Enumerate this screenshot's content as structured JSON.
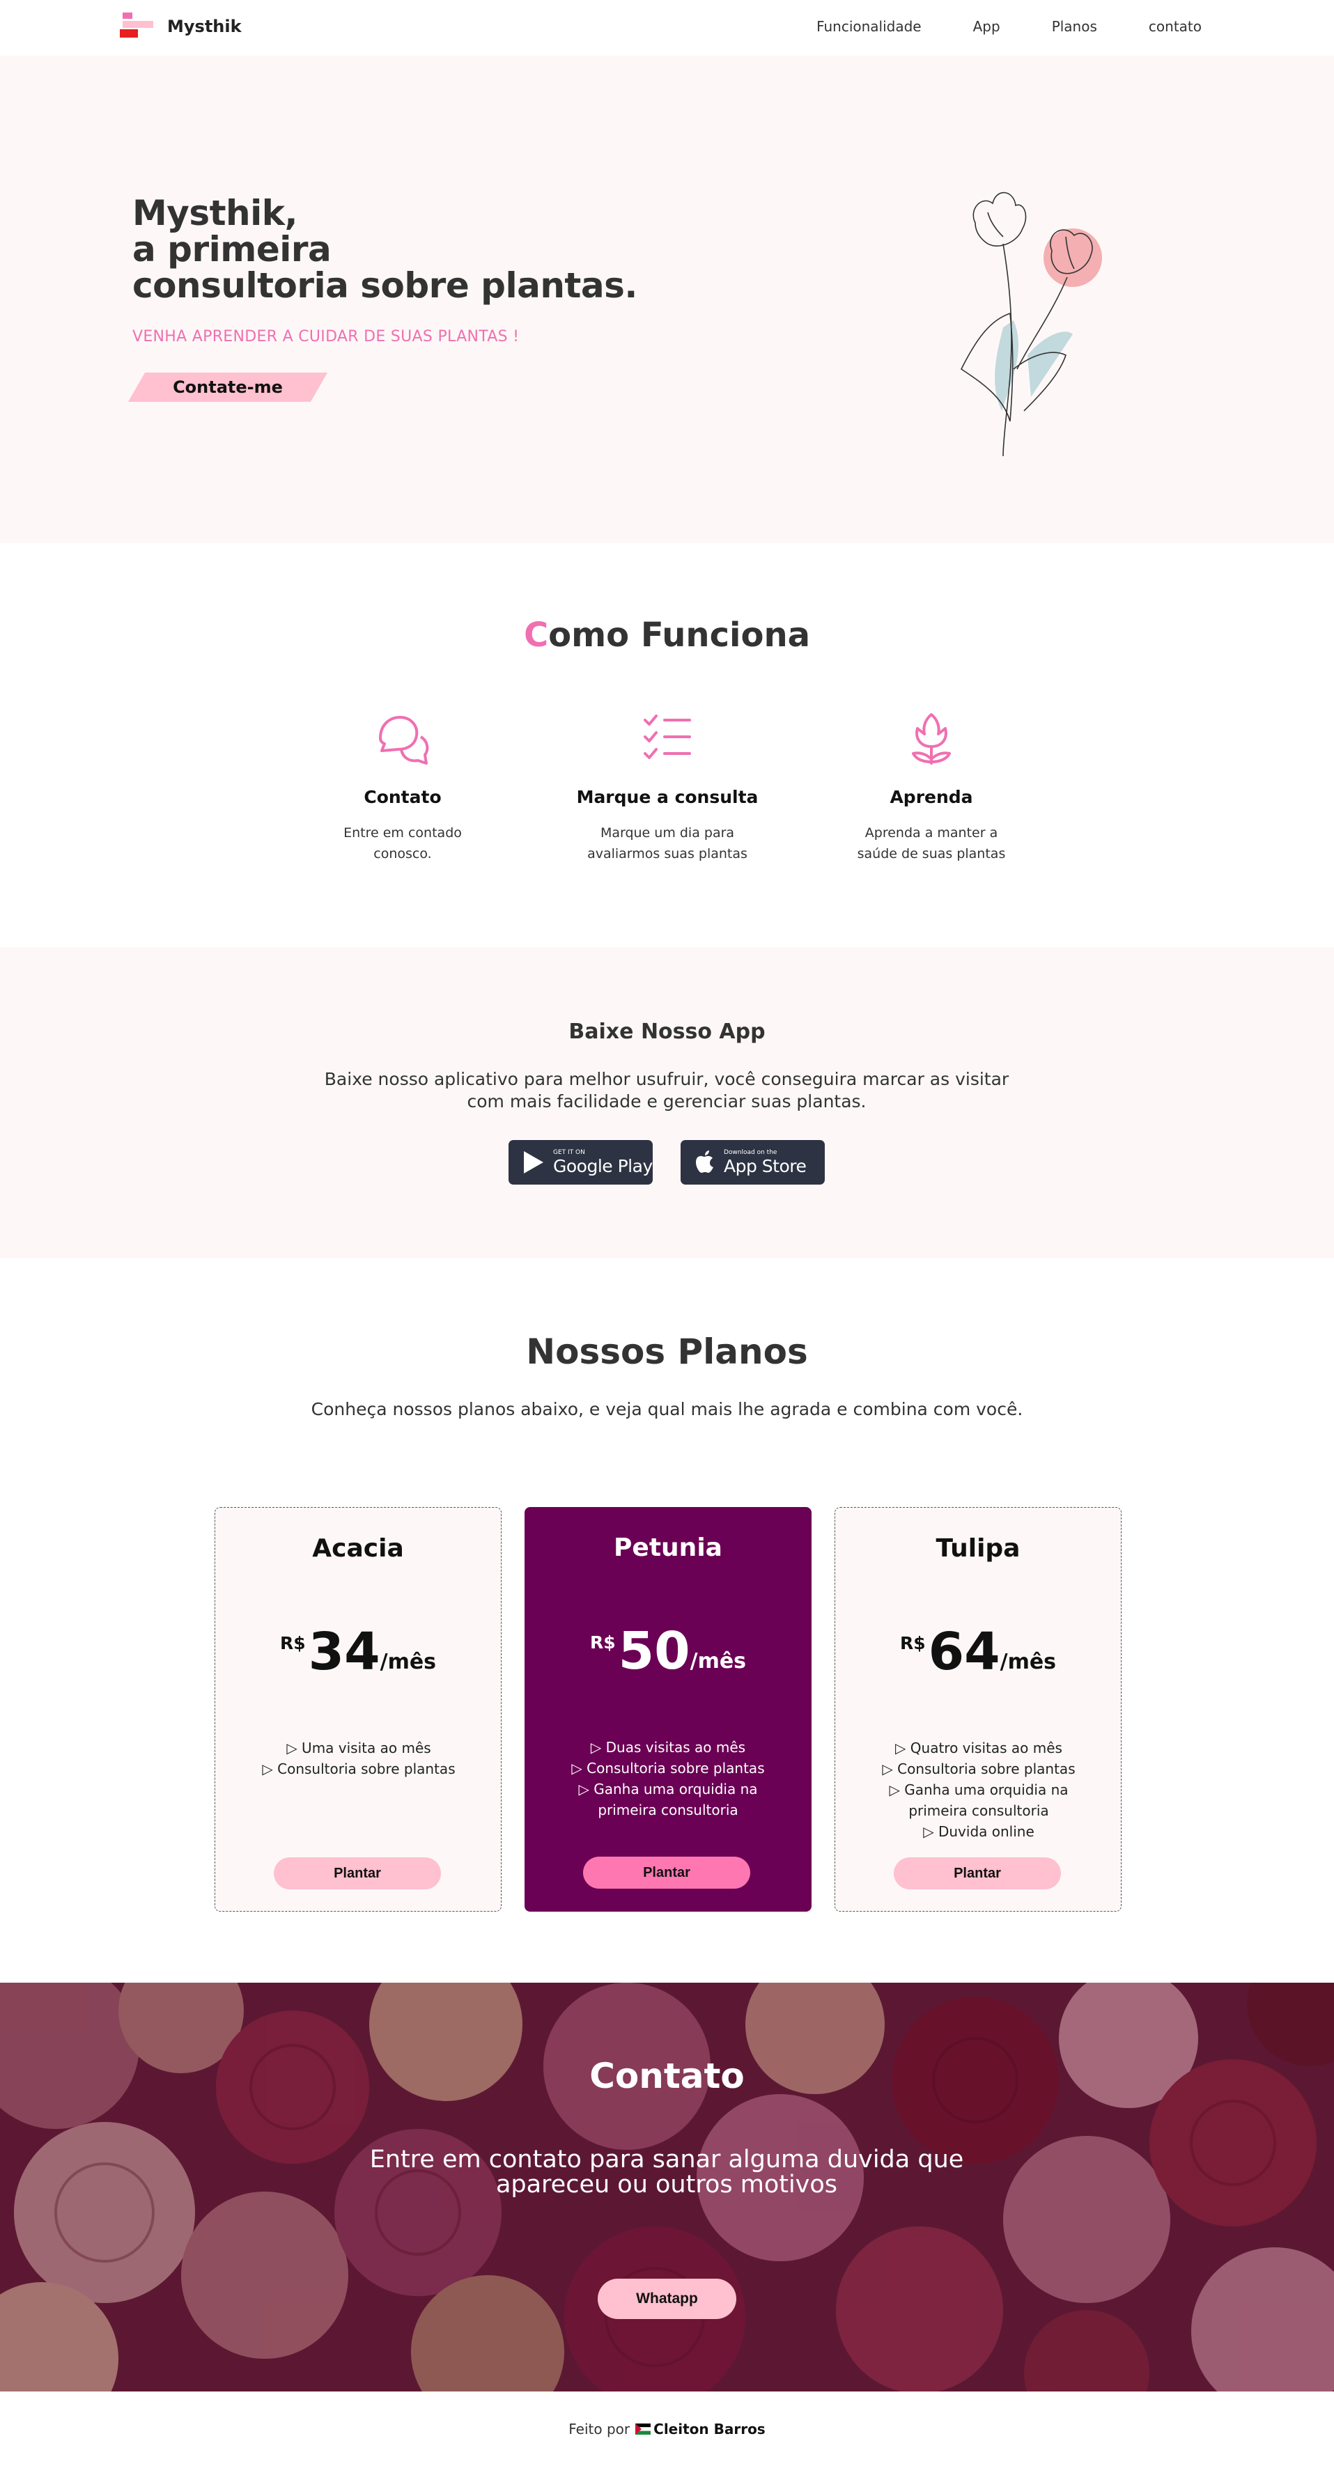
{
  "header": {
    "brand": "Mysthik",
    "nav": [
      "Funcionalidade",
      "App",
      "Planos",
      "contato"
    ]
  },
  "hero": {
    "title_line1": "Mysthik,",
    "title_line2": "a primeira",
    "title_line3": "consultoria sobre plantas.",
    "subtitle": "VENHA APRENDER A CUIDAR DE SUAS PLANTAS !",
    "cta": "Contate-me",
    "illustration_icon": "tulip-illustration"
  },
  "como_funciona": {
    "title_first": "C",
    "title_rest": "omo Funciona",
    "items": [
      {
        "icon": "chat-bubbles-icon",
        "title": "Contato",
        "text_line1": "Entre em contado",
        "text_line2": "conosco."
      },
      {
        "icon": "checklist-icon",
        "title": "Marque a consulta",
        "text_line1": "Marque um dia para",
        "text_line2": "avaliarmos suas plantas"
      },
      {
        "icon": "tulip-icon",
        "title": "Aprenda",
        "text_line1": "Aprenda a manter a",
        "text_line2": "saúde de suas plantas"
      }
    ]
  },
  "app": {
    "title": "Baixe Nosso App",
    "text_line1": "Baixe nosso aplicativo para melhor usufruir, você conseguira marcar as visitar",
    "text_line2": "com mais facilidade e gerenciar suas plantas.",
    "google_small": "GET IT ON",
    "google_big": "Google Play",
    "apple_small": "Download on the",
    "apple_big": "App Store"
  },
  "planos": {
    "title": "Nossos Planos",
    "intro": "Conheça nossos planos abaixo, e veja qual mais lhe agrada e combina com você.",
    "currency": "R$",
    "period": "/mês",
    "button": "Plantar",
    "cards": [
      {
        "name": "Acacia",
        "price": "34",
        "features": [
          "▷ Uma visita ao mês",
          "▷ Consultoria sobre plantas"
        ]
      },
      {
        "name": "Petunia",
        "price": "50",
        "features": [
          "▷ Duas visitas ao mês",
          "▷ Consultoria sobre plantas",
          "▷ Ganha uma orquidia na",
          "primeira consultoria"
        ]
      },
      {
        "name": "Tulipa",
        "price": "64",
        "features": [
          "▷ Quatro visitas ao mês",
          "▷ Consultoria sobre plantas",
          "▷ Ganha uma orquidia na",
          "primeira consultoria",
          "▷ Duvida online"
        ]
      }
    ],
    "accent": "#6b0154"
  },
  "contato": {
    "title": "Contato",
    "text_line1": "Entre em contato para sanar alguma duvida que",
    "text_line2": "apareceu ou outros motivos",
    "button": "Whatapp"
  },
  "footer": {
    "prefix": "Feito por",
    "author": "Cleiton Barros"
  },
  "colors": {
    "accent_pink": "#f06fb1",
    "soft_pink": "#ffc0cf",
    "background": "#fdf8f7"
  }
}
